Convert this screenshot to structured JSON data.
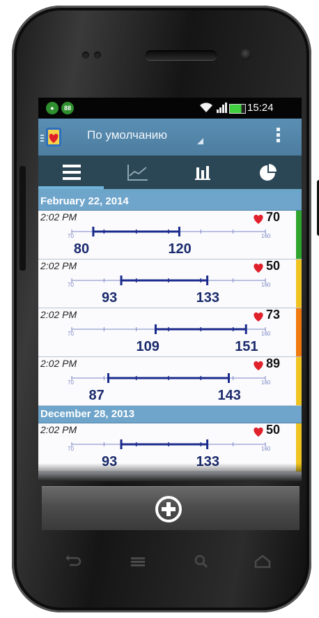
{
  "status_bar": {
    "time": "15:24",
    "notification_badge": "88"
  },
  "action_bar": {
    "title": "По умолчанию",
    "logo_icon": "app-heart-logo-icon",
    "menu_icon": "overflow-menu-icon"
  },
  "tabs": [
    {
      "name": "list",
      "icon": "list-icon",
      "selected": true
    },
    {
      "name": "line-chart",
      "icon": "line-chart-icon",
      "selected": false
    },
    {
      "name": "bar-chart",
      "icon": "bar-chart-icon",
      "selected": false
    },
    {
      "name": "pie-chart",
      "icon": "pie-chart-icon",
      "selected": false
    }
  ],
  "scale": {
    "min_label": "70",
    "max_label": "160"
  },
  "groups": [
    {
      "date": "February 22, 2014",
      "entries": [
        {
          "time": "2:02 PM",
          "pulse": "70",
          "low": "80",
          "high": "120",
          "color": "#2fa52f"
        },
        {
          "time": "2:02 PM",
          "pulse": "50",
          "low": "93",
          "high": "133",
          "color": "#f0c420"
        },
        {
          "time": "2:02 PM",
          "pulse": "73",
          "low": "109",
          "high": "151",
          "color": "#f07a10"
        },
        {
          "time": "2:02 PM",
          "pulse": "89",
          "low": "87",
          "high": "143",
          "color": "#f0c420"
        }
      ]
    },
    {
      "date": "December 28, 2013",
      "entries": [
        {
          "time": "2:02 PM",
          "pulse": "50",
          "low": "93",
          "high": "133",
          "color": "#f0c420"
        }
      ]
    }
  ],
  "bottom_bar": {
    "add_icon": "add-circle-icon"
  },
  "nav_keys": [
    "back-icon",
    "menu-icon",
    "search-icon",
    "home-icon"
  ],
  "colors": {
    "accent": "#6fa5cb",
    "bar": "#1a2a8c",
    "heart": "#e0202a"
  }
}
